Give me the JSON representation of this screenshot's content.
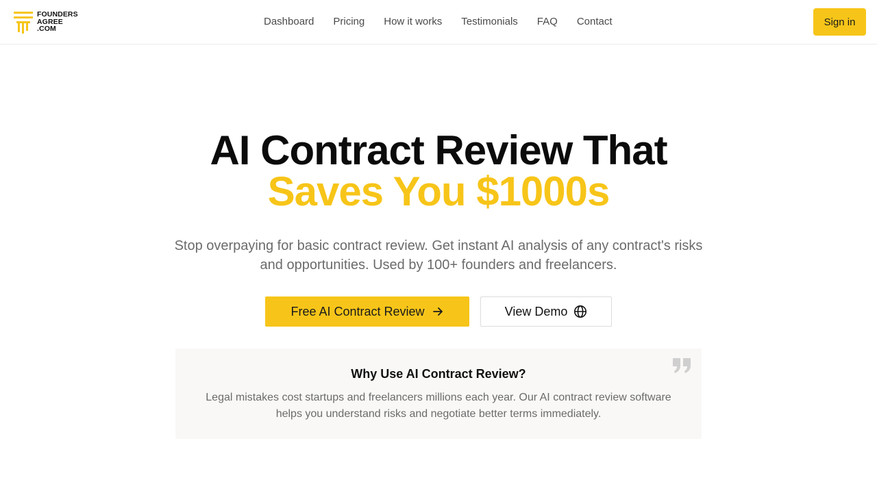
{
  "brand": {
    "logo_lines": [
      "FOUNDERS",
      "AGREE",
      ".COM"
    ],
    "accent_color": "#f7c519",
    "logo_icon": "pillar-logo-icon"
  },
  "nav": {
    "items": [
      {
        "label": "Dashboard"
      },
      {
        "label": "Pricing"
      },
      {
        "label": "How it works"
      },
      {
        "label": "Testimonials"
      },
      {
        "label": "FAQ"
      },
      {
        "label": "Contact"
      }
    ]
  },
  "header": {
    "signin_label": "Sign in"
  },
  "hero": {
    "title_line1": "AI Contract Review That",
    "title_line2": "Saves You $1000s",
    "subtitle": "Stop overpaying for basic contract review. Get instant AI analysis of any contract's risks and opportunities. Used by 100+ founders and freelancers.",
    "primary_cta": "Free AI Contract Review",
    "primary_cta_icon": "arrow-right-icon",
    "secondary_cta": "View Demo",
    "secondary_cta_icon": "globe-icon"
  },
  "info_card": {
    "title": "Why Use AI Contract Review?",
    "text": "Legal mistakes cost startups and freelancers millions each year. Our AI contract review software helps you understand risks and negotiate better terms immediately.",
    "icon": "quote-icon"
  }
}
